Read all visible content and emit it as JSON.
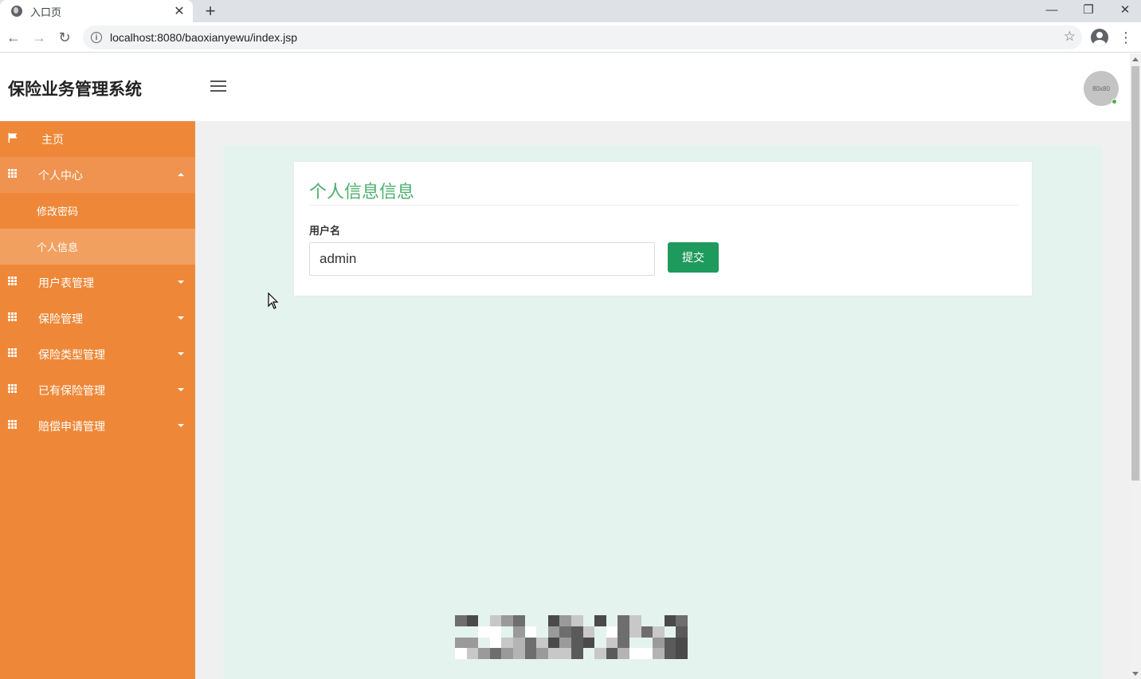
{
  "browser": {
    "tab_title": "入口页",
    "close_glyph": "✕",
    "new_tab_glyph": "+",
    "url": "localhost:8080/baoxianyewu/index.jsp",
    "window_controls": {
      "minimize": "—",
      "maximize": "❐",
      "close": "✕"
    },
    "nav": {
      "back": "←",
      "forward": "→",
      "reload": "↻"
    },
    "star_glyph": "☆",
    "info_glyph": "i",
    "kebab_glyph": "⋮"
  },
  "header": {
    "brand": "保险业务管理系统",
    "avatar_text": "80x80"
  },
  "sidebar": {
    "items": [
      {
        "label": "主页",
        "icon": "flag-icon"
      },
      {
        "label": "个人中心",
        "icon": "grid-icon",
        "expanded": true,
        "children": [
          {
            "label": "修改密码"
          },
          {
            "label": "个人信息",
            "active": true
          }
        ]
      },
      {
        "label": "用户表管理",
        "icon": "grid-icon"
      },
      {
        "label": "保险管理",
        "icon": "grid-icon"
      },
      {
        "label": "保险类型管理",
        "icon": "grid-icon"
      },
      {
        "label": "已有保险管理",
        "icon": "grid-icon"
      },
      {
        "label": "赔偿申请管理",
        "icon": "grid-icon"
      }
    ]
  },
  "main": {
    "card_title": "个人信息信息",
    "username_label": "用户名",
    "username_value": "admin",
    "submit_label": "提交"
  },
  "colors": {
    "sidebar": "#ee8838",
    "sidebar_open": "#f09350",
    "sidebar_active": "#f2a060",
    "content_bg": "#e5f3ee",
    "title_green": "#4caf6e",
    "submit_green": "#1e9a5c"
  }
}
